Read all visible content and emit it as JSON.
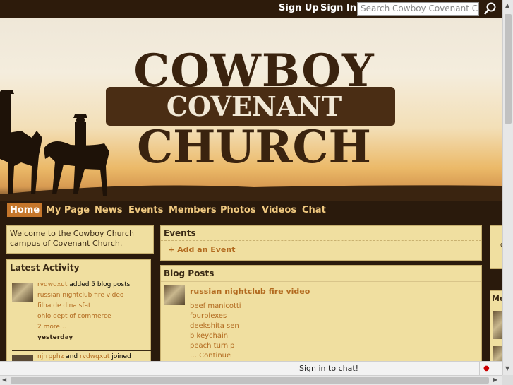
{
  "top": {
    "signup": "Sign Up",
    "signin": "Sign In",
    "search_placeholder": "Search Cowboy Covenant Chu"
  },
  "banner": {
    "line1": "COWBOY",
    "line2": "COVENANT",
    "line3": "CHURCH"
  },
  "nav": [
    "Home",
    "My Page",
    "News",
    "Events",
    "Members",
    "Photos",
    "Videos",
    "Chat"
  ],
  "welcome": {
    "text": "Welcome to the Cowboy Church campus of Covenant Church."
  },
  "activity": {
    "title": "Latest Activity",
    "item1": {
      "user": "rvdwqxut",
      "action": "added 5 blog posts",
      "links": [
        "russian nightclub fire video",
        "filha de dina sfat",
        "ohio dept of commerce"
      ],
      "more": "2 more…",
      "time": "yesterday"
    },
    "item2": {
      "user": "njrrpphz",
      "conj": "and",
      "user2": "rvdwqxut",
      "action": "joined"
    }
  },
  "events": {
    "title": "Events",
    "add": "Add an Event"
  },
  "blog": {
    "title": "Blog Posts",
    "post_title": "russian nightclub fire video",
    "lines": [
      "beef manicotti",
      "fourplexes",
      "deekshita sen",
      "b keychain",
      "peach turnip",
      "… Continue"
    ]
  },
  "right": {
    "c": "C",
    "me": "Me"
  },
  "chat": {
    "label": "Sign in to chat!"
  }
}
